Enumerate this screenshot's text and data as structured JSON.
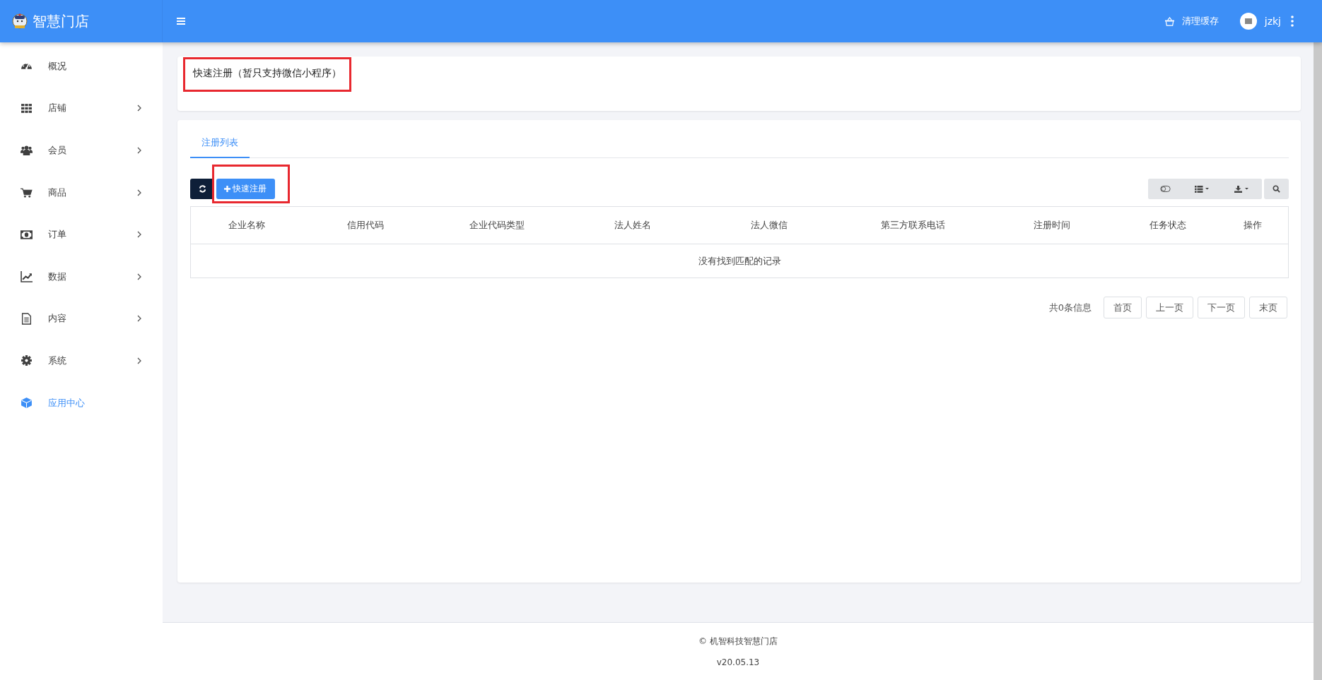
{
  "header": {
    "logo_text": "智慧门店",
    "clear_cache": "清理缓存",
    "username": "jzkj"
  },
  "sidebar": {
    "items": [
      {
        "label": "概况",
        "has_submenu": false,
        "selected": false
      },
      {
        "label": "店铺",
        "has_submenu": true,
        "selected": false
      },
      {
        "label": "会员",
        "has_submenu": true,
        "selected": false
      },
      {
        "label": "商品",
        "has_submenu": true,
        "selected": false
      },
      {
        "label": "订单",
        "has_submenu": true,
        "selected": false
      },
      {
        "label": "数据",
        "has_submenu": true,
        "selected": false
      },
      {
        "label": "内容",
        "has_submenu": true,
        "selected": false
      },
      {
        "label": "系统",
        "has_submenu": true,
        "selected": false
      },
      {
        "label": "应用中心",
        "has_submenu": false,
        "selected": true
      }
    ]
  },
  "notice": {
    "text": "快速注册（暂只支持微信小程序）",
    "highlighted": true
  },
  "tabs": [
    {
      "label": "注册列表",
      "selected": true
    }
  ],
  "toolbar": {
    "add_button": {
      "label": "快速注册",
      "highlighted": true
    }
  },
  "table": {
    "columns": [
      "企业名称",
      "信用代码",
      "企业代码类型",
      "法人姓名",
      "法人微信",
      "第三方联系电话",
      "注册时间",
      "任务状态",
      "操作"
    ],
    "empty_message": "没有找到匹配的记录"
  },
  "pagination": {
    "summary": "共0条信息",
    "buttons": [
      "首页",
      "上一页",
      "下一页",
      "末页"
    ]
  },
  "footer": {
    "copyright": "© 机智科技智慧门店",
    "version": "v20.05.13"
  }
}
